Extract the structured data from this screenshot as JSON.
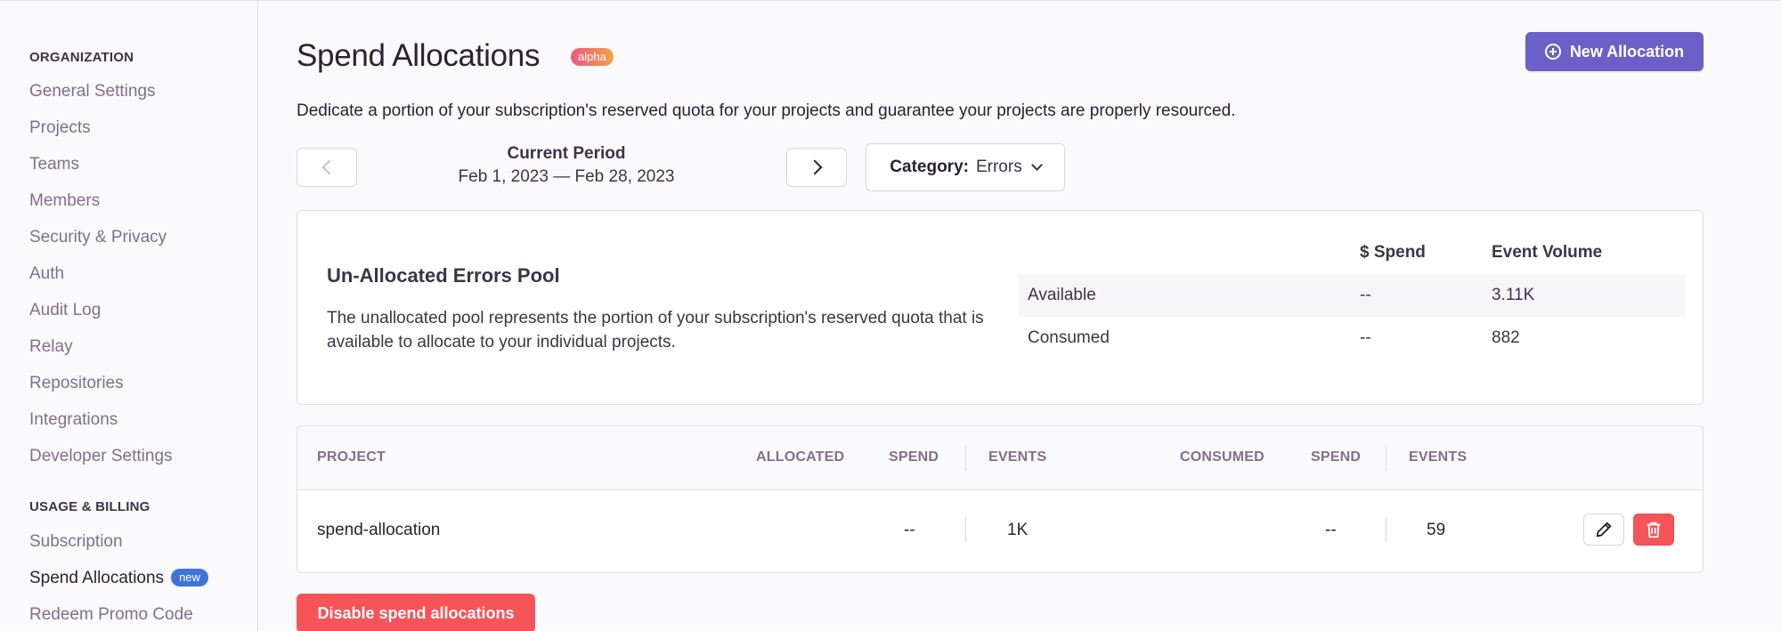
{
  "sidebar": {
    "sections": [
      {
        "heading": "ORGANIZATION",
        "items": [
          {
            "label": "General Settings"
          },
          {
            "label": "Projects"
          },
          {
            "label": "Teams"
          },
          {
            "label": "Members"
          },
          {
            "label": "Security & Privacy"
          },
          {
            "label": "Auth"
          },
          {
            "label": "Audit Log"
          },
          {
            "label": "Relay"
          },
          {
            "label": "Repositories"
          },
          {
            "label": "Integrations"
          },
          {
            "label": "Developer Settings"
          }
        ]
      },
      {
        "heading": "USAGE & BILLING",
        "items": [
          {
            "label": "Subscription"
          },
          {
            "label": "Spend Allocations",
            "badge": "new",
            "active": true
          },
          {
            "label": "Redeem Promo Code"
          }
        ]
      }
    ]
  },
  "header": {
    "title": "Spend Allocations",
    "title_badge": "alpha",
    "new_button_label": "New Allocation",
    "description": "Dedicate a portion of your subscription's reserved quota for your projects and guarantee your projects are properly resourced."
  },
  "period": {
    "title": "Current Period",
    "range": "Feb 1, 2023 — Feb 28, 2023"
  },
  "category": {
    "label": "Category:",
    "value": "Errors"
  },
  "pool": {
    "title": "Un-Allocated Errors Pool",
    "description": "The unallocated pool represents the portion of your subscription's reserved quota that is available to allocate to your individual projects.",
    "columns": [
      "$ Spend",
      "Event Volume"
    ],
    "rows": [
      {
        "label": "Available",
        "spend": "--",
        "volume": "3.11K"
      },
      {
        "label": "Consumed",
        "spend": "--",
        "volume": "882"
      }
    ]
  },
  "table": {
    "headers": {
      "project": "PROJECT",
      "allocated": "ALLOCATED",
      "spend1": "SPEND",
      "events1": "EVENTS",
      "consumed": "CONSUMED",
      "spend2": "SPEND",
      "events2": "EVENTS"
    },
    "rows": [
      {
        "project": "spend-allocation",
        "allocated_spend": "--",
        "allocated_events": "1K",
        "consumed_spend": "--",
        "consumed_events": "59"
      }
    ]
  },
  "footer": {
    "disable_label": "Disable spend allocations"
  },
  "colors": {
    "accent": "#6c5fc7",
    "danger": "#f55459",
    "badge_new": "#3d74db"
  },
  "icons": [
    "plus-circle-icon",
    "chevron-left-icon",
    "chevron-right-icon",
    "chevron-down-icon",
    "pencil-icon",
    "trash-icon"
  ]
}
